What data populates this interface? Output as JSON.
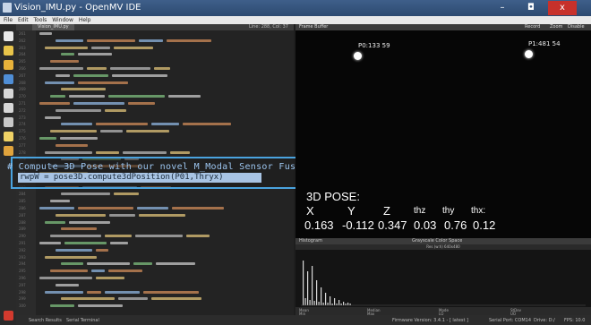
{
  "window": {
    "title": "Vision_IMU.py - OpenMV IDE",
    "minimize": "–",
    "maximize": "◘",
    "close": "x"
  },
  "menu": [
    "File",
    "Edit",
    "Tools",
    "Window",
    "Help"
  ],
  "toolbar": [
    "connect-icon",
    "new-file-icon",
    "open-file-icon",
    "save-icon",
    "undo-icon",
    "redo-icon",
    "cut-icon",
    "copy-icon",
    "paste-icon"
  ],
  "editor": {
    "tab_label": "Vision_IMU.py",
    "cursor_pos": "Line: 288, Col: 37",
    "line_numbers": [
      "261",
      "262",
      "263",
      "264",
      "265",
      "266",
      "267",
      "268",
      "269",
      "270",
      "271",
      "272",
      "273",
      "274",
      "275",
      "276",
      "277",
      "278",
      "279",
      "280",
      "281",
      "282",
      "283",
      "284",
      "285",
      "286",
      "287",
      "288",
      "289",
      "290",
      "291",
      "292",
      "293",
      "294",
      "295",
      "296",
      "297",
      "298",
      "299",
      "300"
    ]
  },
  "overlay": {
    "comment": "# Compute 3D Pose with our novel M_Modal Sensor Fusion",
    "code": "rwpW = pose3D.compute3dPosition(P01,Thryx)"
  },
  "frame_buffer": {
    "header": "Frame Buffer",
    "controls": [
      "Record",
      "Zoom",
      "Disable"
    ],
    "points": [
      {
        "label": "P0:133 59"
      },
      {
        "label": "P1:481 54"
      }
    ],
    "pose": {
      "title": "3D POSE:",
      "headers": [
        "X",
        "Y",
        "Z",
        "thz",
        "thy",
        "thx:"
      ],
      "values": [
        "0.163",
        "-0.112",
        "0.347",
        "0.03",
        "0.76",
        "0.12"
      ]
    }
  },
  "histogram": {
    "header": "Histogram",
    "colorspace": "Grayscale Color Space",
    "resolution": "Res (w:h) 640x480",
    "stats": [
      "Mean",
      "Median",
      "Mode",
      "StDev",
      "Min",
      "Max",
      "LQ",
      "UQ"
    ]
  },
  "statusbar": {
    "search": "Search Results",
    "terminal": "Serial Terminal",
    "firmware": "Firmware Version: 3.4.1 - [ latest ]",
    "port": "Serial Port: COM14",
    "drive": "Drive: D:/",
    "fps": "FPS: 10.0"
  }
}
